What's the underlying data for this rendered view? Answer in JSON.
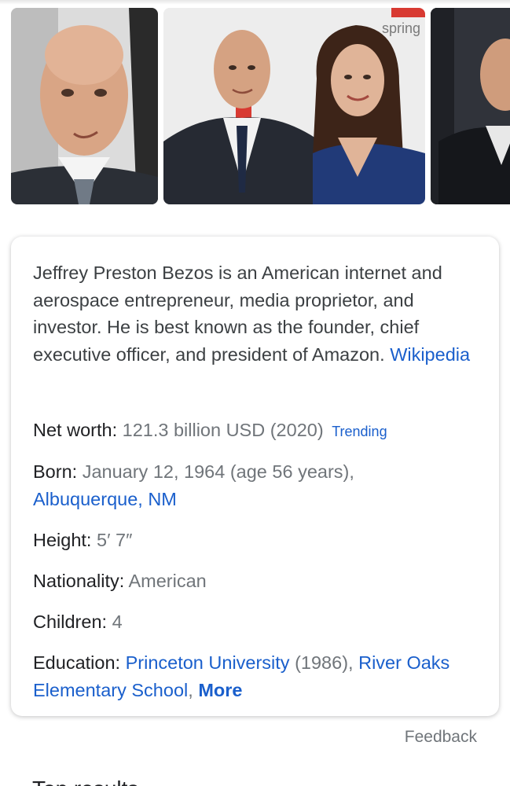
{
  "images": [
    {
      "name": "portrait-close-up"
    },
    {
      "name": "couple-event-photo",
      "backdrop_text": "spring"
    },
    {
      "name": "portrait-partial"
    }
  ],
  "description": {
    "text": "Jeffrey Preston Bezos is an American internet and aerospace entrepreneur, media proprietor, and investor. He is best known as the founder, chief executive officer, and president of Amazon.",
    "source_link": "Wikipedia"
  },
  "facts": {
    "net_worth": {
      "label": "Net worth:",
      "value": "121.3 billion USD (2020)",
      "badge": "Trending"
    },
    "born": {
      "label": "Born:",
      "value": "January 12, 1964 (age 56 years),",
      "place": "Albuquerque, NM"
    },
    "height": {
      "label": "Height:",
      "value": "5′ 7″"
    },
    "nationality": {
      "label": "Nationality:",
      "value": "American"
    },
    "children": {
      "label": "Children:",
      "value": "4"
    },
    "education": {
      "label": "Education:",
      "school_1": "Princeton University",
      "school_1_year": "(1986),",
      "school_2": "River Oaks Elementary School",
      "separator": ",",
      "more": "More"
    }
  },
  "feedback": "Feedback",
  "next_section_heading": "Top results",
  "colors": {
    "link": "#1a5fcc",
    "muted": "#70757a",
    "text": "#202124"
  }
}
